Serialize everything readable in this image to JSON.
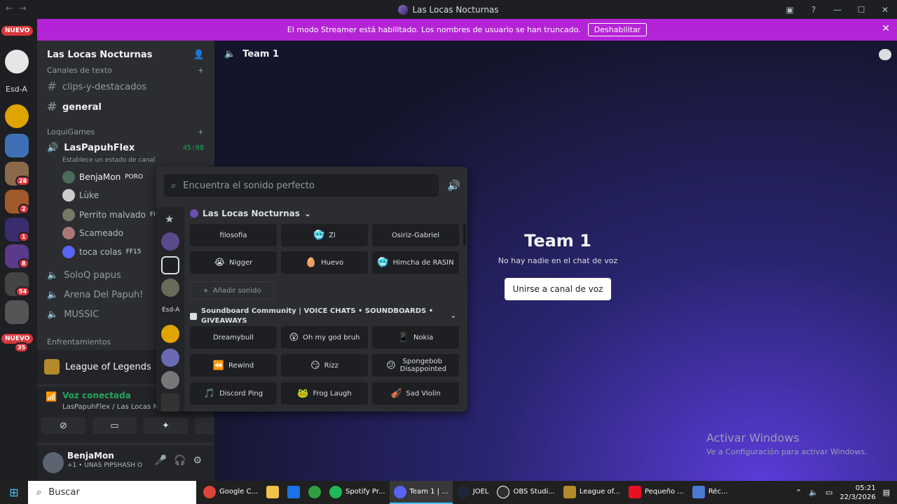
{
  "window": {
    "title": "Las Locas Nocturnas"
  },
  "banner": {
    "text": "El modo Streamer está habilitado. Los nombres de usuario se han truncado.",
    "button": "Deshabilitar"
  },
  "guild_bar": {
    "nuevo_top": "NUEVO",
    "esd_label": "Esd-A",
    "badges": [
      "28",
      "2",
      "1",
      "8",
      "54"
    ],
    "nuevo_bottom": "NUEVO",
    "nuevo_bottom_count": "35"
  },
  "server": {
    "name": "Las Locas Nocturnas"
  },
  "channels": {
    "cat_text": "Canales de texto",
    "text_channels": [
      "clips-y-destacados",
      "general"
    ],
    "cat_games": "LoquiGames",
    "voice_active": {
      "name": "LasPapuhFlex",
      "timer": "45:08",
      "status": "Establece un estado de canal"
    },
    "members": [
      {
        "name": "BenjaMon",
        "tag": "PORO"
      },
      {
        "name": "Lùke",
        "tag": ""
      },
      {
        "name": "Perrito malvado",
        "tag": "FI"
      },
      {
        "name": "Scameado",
        "tag": ""
      },
      {
        "name": "toca colas",
        "tag": "FF15"
      }
    ],
    "voice_others": [
      "SoloQ papus",
      "Arena Del Papuh!",
      "MUSSIC"
    ],
    "cat_enfrentamientos": "Enfrentamientos"
  },
  "activity": {
    "game": "League of Legends"
  },
  "voice_panel": {
    "title": "Voz conectada",
    "sub": "LasPapuhFlex / Las Locas Nocturnas"
  },
  "user_panel": {
    "name": "BenjaMon",
    "status": "+1 • UNAS PIPSHASH O"
  },
  "main": {
    "channel": "Team 1",
    "heading": "Team 1",
    "empty_text": "No hay nadie en el chat de voz",
    "join_button": "Unirse a canal de voz"
  },
  "watermark": {
    "line1": "Activar Windows",
    "line2": "Ve a Configuración para activar Windows."
  },
  "soundboard": {
    "search_placeholder": "Encuentra el sonido perfecto",
    "rail_label": "Esd-A",
    "section1": "Las Locas Nocturnas",
    "sounds1": [
      {
        "label": "filosofia",
        "emoji": ""
      },
      {
        "label": "Zi",
        "emoji": "🥶"
      },
      {
        "label": "Osiriz-Gabriel",
        "emoji": ""
      },
      {
        "label": "Nigger",
        "emoji": "😭"
      },
      {
        "label": "Huevo",
        "emoji": "🥚"
      },
      {
        "label": "Himcha de RASIN",
        "emoji": "🥶"
      }
    ],
    "add_label": "Añadir sonido",
    "section2": "Soundboard Community | VOICE CHATS • SOUNDBOARDS • GIVEAWAYS",
    "sounds2": [
      {
        "label": "Dreamybull",
        "emoji": ""
      },
      {
        "label": "Oh my god bruh",
        "emoji": "😲"
      },
      {
        "label": "Nokia",
        "emoji": "📱"
      },
      {
        "label": "Rewind",
        "emoji": "⏪"
      },
      {
        "label": "Rizz",
        "emoji": "😏"
      },
      {
        "label": "Spongebob Disappointed",
        "emoji": "😕"
      },
      {
        "label": "Discord Ping",
        "emoji": "🎵"
      },
      {
        "label": "Frog Laugh",
        "emoji": "🐸"
      },
      {
        "label": "Sad Violin",
        "emoji": "🎻"
      }
    ]
  },
  "taskbar": {
    "search": "Buscar",
    "apps": [
      "Google C...",
      "",
      "",
      "",
      "Spotify Pr...",
      "Team 1 | ...",
      "JOEL",
      "OBS Studi...",
      "League of...",
      "Pequeño ...",
      "Réc..."
    ],
    "time": "05:21",
    "date": "22/3/2026"
  }
}
